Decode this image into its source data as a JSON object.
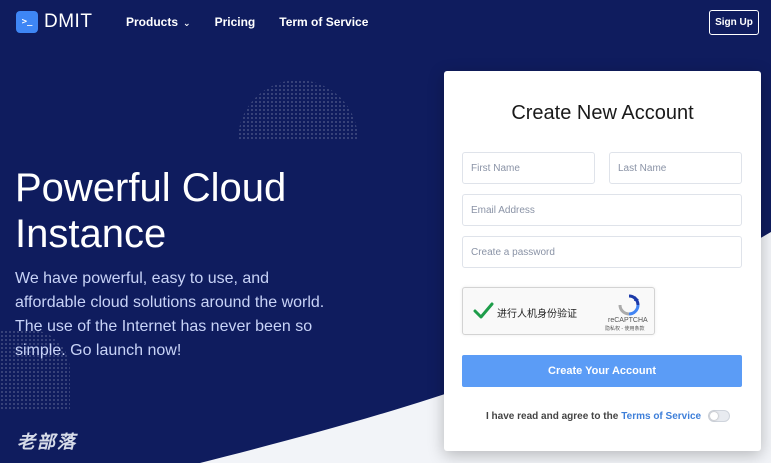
{
  "header": {
    "logo_glyph": ">_",
    "logo_text": "DMIT",
    "nav": [
      "Products",
      "Pricing",
      "Term of Service"
    ],
    "products_chevron_icon": "chevron-down-icon",
    "signup_label": "Sign Up"
  },
  "hero": {
    "title": "Powerful Cloud Instance",
    "subtitle": "We have powerful, easy to use, and affordable cloud solutions around the world. The use of the Internet has never been so simple. Go launch now!",
    "watermark": "老部落"
  },
  "form": {
    "title": "Create New Account",
    "first_name_placeholder": "First Name",
    "last_name_placeholder": "Last Name",
    "email_placeholder": "Email Address",
    "password_placeholder": "Create a password",
    "captcha": {
      "label": "进行人机身份验证",
      "brand": "reCAPTCHA",
      "links": "隐私权 - 使用条款",
      "checked": true
    },
    "submit_label": "Create Your Account",
    "agree_text": "I have read and agree to the",
    "tos_link": "Terms of Service",
    "toggle_on": false
  },
  "colors": {
    "background": "#0f1c5e",
    "accent": "#3e86f5",
    "button": "#5b9cf6",
    "link": "#3e7fd9"
  }
}
